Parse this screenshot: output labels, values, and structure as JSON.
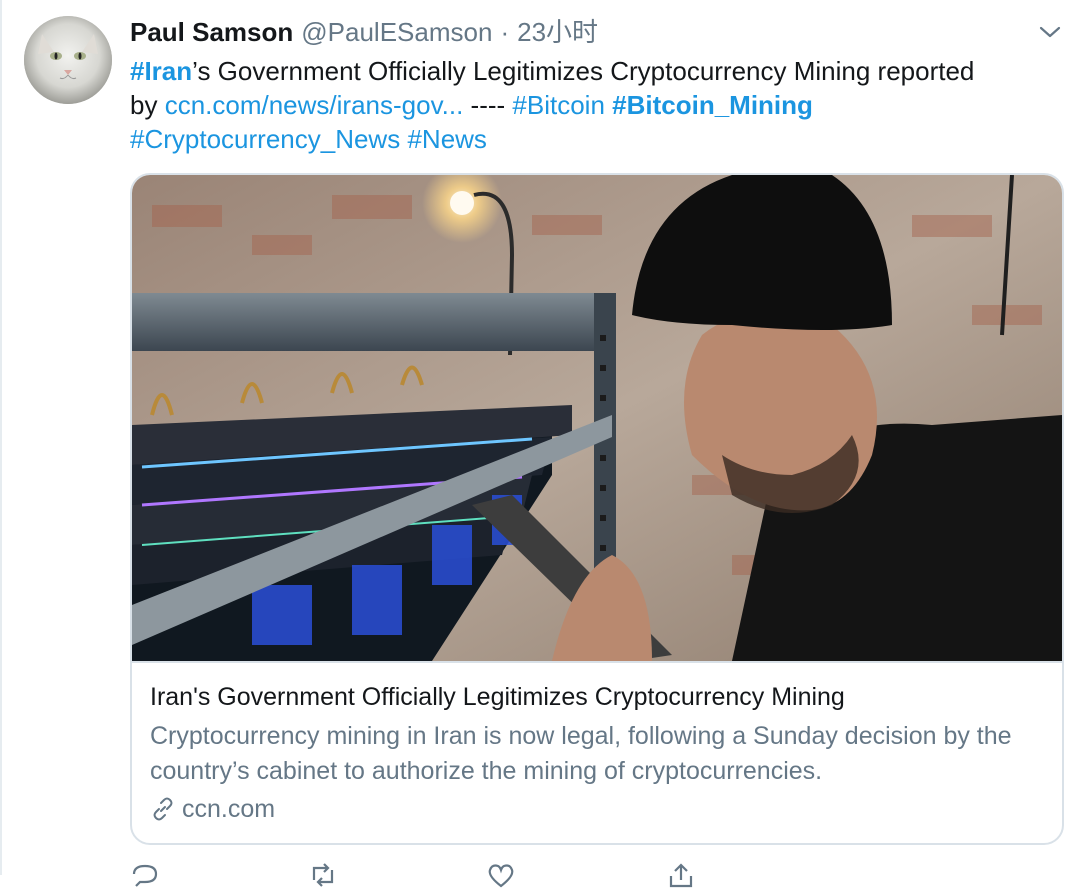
{
  "tweet": {
    "author_name": "Paul Samson",
    "author_handle": "@PaulESamson",
    "separator": "·",
    "time": "23小时",
    "text": {
      "tag_iran": "#Iran",
      "line1_rest": "’s Government Officially Legitimizes Cryptocurrency Mining reported",
      "by": "by ",
      "link": "ccn.com/news/irans-gov...",
      "dashes": " ---- ",
      "tag_bitcoin": "#Bitcoin",
      "tag_bitcoin_mining": "#Bitcoin_Mining",
      "tag_crypto_news": "#Cryptocurrency_News",
      "tag_news": "#News"
    },
    "card": {
      "title": "Iran's Government Officially Legitimizes Cryptocurrency Mining",
      "description": "Cryptocurrency mining in Iran is now legal, following a Sunday decision by the country’s cabinet to authorize the mining of cryptocurrencies.",
      "domain": "ccn.com"
    },
    "icons": {
      "menu": "chevron-down-icon",
      "link": "link-icon",
      "reply": "reply-icon",
      "retweet": "retweet-icon",
      "like": "heart-icon",
      "share": "share-icon"
    }
  },
  "colors": {
    "link": "#1b95e0",
    "secondary_text": "#657786",
    "primary_text": "#14171a",
    "border": "#d9e1e8"
  }
}
